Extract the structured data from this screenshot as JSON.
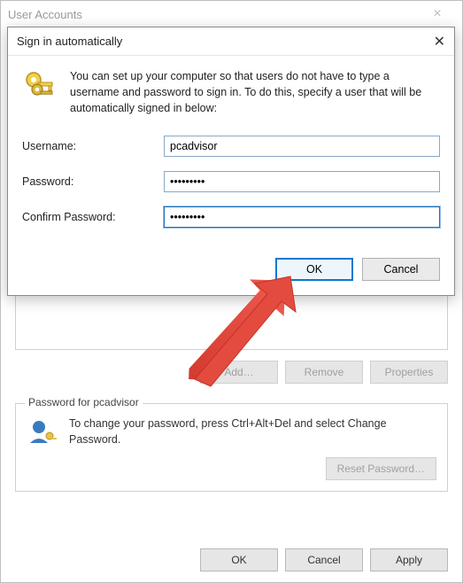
{
  "parent": {
    "title": "User Accounts",
    "buttons": {
      "add": "Add…",
      "remove": "Remove",
      "properties": "Properties"
    },
    "group": {
      "legend": "Password for pcadvisor",
      "text": "To change your password, press Ctrl+Alt+Del and select Change Password.",
      "reset": "Reset Password…"
    },
    "footer": {
      "ok": "OK",
      "cancel": "Cancel",
      "apply": "Apply"
    }
  },
  "modal": {
    "title": "Sign in automatically",
    "description": "You can set up your computer so that users do not have to type a username and password to sign in. To do this, specify a user that will be automatically signed in below:",
    "labels": {
      "username": "Username:",
      "password": "Password:",
      "confirm": "Confirm Password:"
    },
    "values": {
      "username": "pcadvisor",
      "password": "•••••••••",
      "confirm": "•••••••••"
    },
    "buttons": {
      "ok": "OK",
      "cancel": "Cancel"
    }
  }
}
